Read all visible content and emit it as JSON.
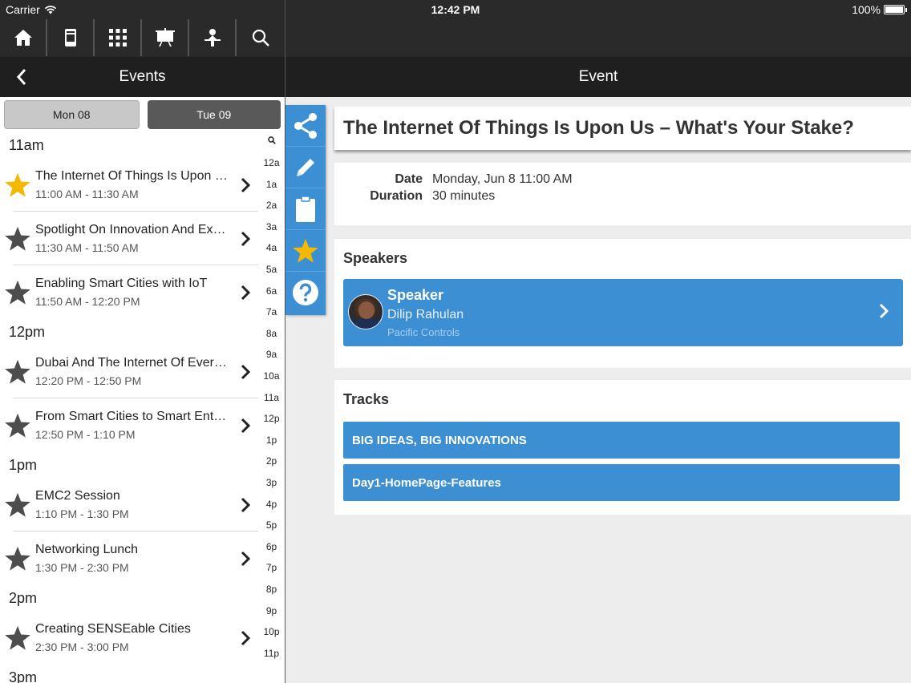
{
  "status_bar": {
    "carrier": "Carrier",
    "time": "12:42 PM",
    "battery": "100%"
  },
  "toolbar": {
    "icons": [
      "home-icon",
      "device-icon",
      "grid-icon",
      "presentation-icon",
      "exhibitor-icon",
      "search-icon"
    ]
  },
  "left_nav": {
    "title": "Events"
  },
  "right_nav": {
    "title": "Event"
  },
  "day_tabs": [
    {
      "label": "Mon 08",
      "selected": true
    },
    {
      "label": "Tue 09",
      "selected": false
    }
  ],
  "schedule": {
    "hours": [
      {
        "label": "11am",
        "events": [
          {
            "title": "The Internet Of Things Is Upon Us – What's Your Stake?",
            "time": "11:00 AM - 11:30 AM",
            "favorite": true
          },
          {
            "title": "Spotlight On Innovation And Excellence",
            "time": "11:30 AM - 11:50 AM",
            "favorite": false
          },
          {
            "title": "Enabling Smart Cities with IoT",
            "time": "11:50 AM - 12:20 PM",
            "favorite": false
          }
        ]
      },
      {
        "label": "12pm",
        "events": [
          {
            "title": "Dubai And The Internet Of Everything",
            "time": "12:20 PM - 12:50 PM",
            "favorite": false
          },
          {
            "title": "From Smart Cities to Smart Enterprises",
            "time": "12:50 PM - 1:10 PM",
            "favorite": false
          }
        ]
      },
      {
        "label": "1pm",
        "events": [
          {
            "title": "EMC2 Session",
            "time": "1:10 PM - 1:30 PM",
            "favorite": false
          },
          {
            "title": "Networking Lunch",
            "time": "1:30 PM - 2:30 PM",
            "favorite": false
          }
        ]
      },
      {
        "label": "2pm",
        "events": [
          {
            "title": "Creating SENSEable Cities",
            "time": "2:30 PM - 3:00 PM",
            "favorite": false
          }
        ]
      },
      {
        "label": "3pm",
        "events": []
      }
    ]
  },
  "time_index": [
    "12a",
    "1a",
    "2a",
    "3a",
    "4a",
    "5a",
    "6a",
    "7a",
    "8a",
    "9a",
    "10a",
    "11a",
    "12p",
    "1p",
    "2p",
    "3p",
    "4p",
    "5p",
    "6p",
    "7p",
    "8p",
    "9p",
    "10p",
    "11p"
  ],
  "event": {
    "title": "The Internet Of Things Is Upon Us – What's Your Stake?",
    "date_label": "Date",
    "date_value": "Monday, Jun 8 11:00 AM",
    "duration_label": "Duration",
    "duration_value": "30 minutes",
    "speakers_title": "Speakers",
    "speaker": {
      "role": "Speaker",
      "name": "Dilip Rahulan",
      "organization": "Pacific Controls"
    },
    "tracks_title": "Tracks",
    "tracks": [
      "BIG IDEAS, BIG INNOVATIONS",
      "Day1-HomePage-Features"
    ]
  },
  "actions": [
    "share-icon",
    "edit-icon",
    "clipboard-icon",
    "favorite-star-icon",
    "help-icon"
  ],
  "colors": {
    "accent": "#3d8fd4",
    "star_active": "#f5b800",
    "star_inactive": "#4d4d4d",
    "nav_bg": "#1f1f1f"
  }
}
